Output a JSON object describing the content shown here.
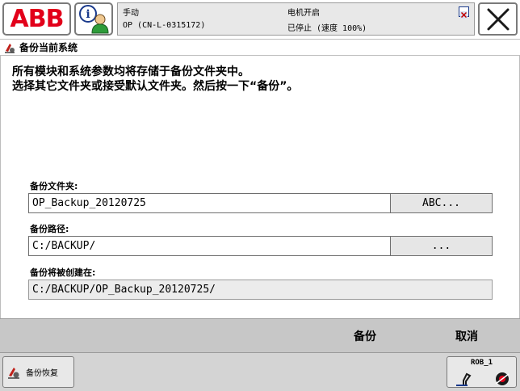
{
  "topbar": {
    "logo_text": "ABB",
    "mode": "手动",
    "system": "OP (CN-L-0315172)",
    "motor_status": "电机开启",
    "run_status": "已停止 (速度 100%)",
    "icons": {
      "info": "info-user-icon",
      "status_close": "small-close-icon",
      "close": "close-x-icon"
    },
    "colors": {
      "logo": "#e2001a"
    }
  },
  "window": {
    "title": "备份当前系统",
    "icon": "backup-app-icon"
  },
  "content": {
    "instructions": [
      "所有模块和系统参数均将存储于备份文件夹中。",
      "选择其它文件夹或接受默认文件夹。然后按一下“备份”。"
    ],
    "folder": {
      "label": "备份文件夹:",
      "value": "OP_Backup_20120725",
      "button": "ABC..."
    },
    "path": {
      "label": "备份路径:",
      "value": "C:/BACKUP/",
      "button": "..."
    },
    "created": {
      "label": "备份将被创建在:",
      "value": "C:/BACKUP/OP_Backup_20120725/"
    }
  },
  "commands": {
    "backup": "备份",
    "cancel": "取消"
  },
  "taskbar": {
    "task_label": "备份恢复",
    "rob_label": "ROB_1"
  }
}
